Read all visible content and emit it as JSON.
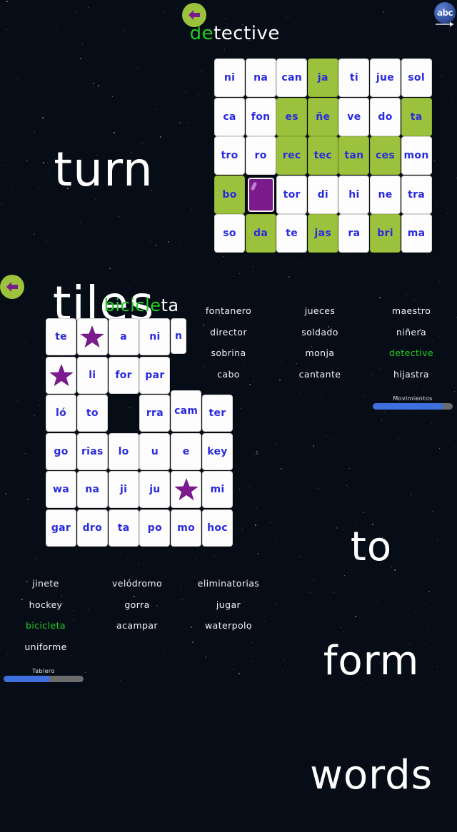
{
  "app": {
    "background_color": "#070d16",
    "tile_face_color": "#fdfdfd",
    "tile_green_color": "#9cc23d",
    "tile_purple_color": "#7a1a8c",
    "tile_text_color": "#2a2ae0",
    "found_word_color": "#1fd01f",
    "progress_fill_color": "#3f6fdc"
  },
  "headings": {
    "left_heading_line1": "turn",
    "left_heading_line2": "tiles",
    "right_heading_line1": "to",
    "right_heading_line2": "form",
    "right_heading_line3": "words"
  },
  "top_panel": {
    "back_button": {
      "name": "back-arrow-icon",
      "color": "#7a1a8c"
    },
    "abc_button": {
      "label": "abc",
      "name": "abc-icon"
    },
    "title": {
      "solved_part": "de",
      "remaining_part": "tective",
      "full": "detective"
    },
    "grid": {
      "columns": 7,
      "rows": 5,
      "tiles": [
        {
          "text": "ni",
          "state": "white"
        },
        {
          "text": "na",
          "state": "white"
        },
        {
          "text": "can",
          "state": "white"
        },
        {
          "text": "ja",
          "state": "green"
        },
        {
          "text": "ti",
          "state": "white"
        },
        {
          "text": "jue",
          "state": "white"
        },
        {
          "text": "sol",
          "state": "white"
        },
        {
          "text": "ca",
          "state": "white"
        },
        {
          "text": "fon",
          "state": "white"
        },
        {
          "text": "es",
          "state": "green"
        },
        {
          "text": "ñe",
          "state": "green"
        },
        {
          "text": "ve",
          "state": "white"
        },
        {
          "text": "do",
          "state": "white"
        },
        {
          "text": "ta",
          "state": "green"
        },
        {
          "text": "tro",
          "state": "white"
        },
        {
          "text": "ro",
          "state": "white"
        },
        {
          "text": "rec",
          "state": "green"
        },
        {
          "text": "tec",
          "state": "green"
        },
        {
          "text": "tan",
          "state": "green"
        },
        {
          "text": "ces",
          "state": "green"
        },
        {
          "text": "mon",
          "state": "white"
        },
        {
          "text": "bo",
          "state": "green"
        },
        {
          "text": "",
          "state": "purple"
        },
        {
          "text": "tor",
          "state": "white"
        },
        {
          "text": "di",
          "state": "white"
        },
        {
          "text": "hi",
          "state": "white"
        },
        {
          "text": "ne",
          "state": "white"
        },
        {
          "text": "tra",
          "state": "white"
        },
        {
          "text": "so",
          "state": "white"
        },
        {
          "text": "da",
          "state": "green"
        },
        {
          "text": "te",
          "state": "white"
        },
        {
          "text": "jas",
          "state": "green"
        },
        {
          "text": "ra",
          "state": "white"
        },
        {
          "text": "bri",
          "state": "green"
        },
        {
          "text": "ma",
          "state": "white"
        }
      ]
    }
  },
  "bottom_panel": {
    "back_button": {
      "name": "back-arrow-icon",
      "color": "#7a1a8c"
    },
    "title": {
      "solved_part": "bicicle",
      "remaining_part": "ta",
      "full": "bicicleta"
    },
    "grid": {
      "columns": 6,
      "rows": 6,
      "tiles": [
        {
          "text": "te",
          "state": "white"
        },
        {
          "text": "",
          "state": "star"
        },
        {
          "text": "a",
          "state": "white"
        },
        {
          "text": "ni",
          "state": "white"
        },
        {
          "text": "n",
          "state": "white"
        },
        {
          "text": "",
          "state": "empty"
        },
        {
          "text": "",
          "state": "star"
        },
        {
          "text": "li",
          "state": "white"
        },
        {
          "text": "for",
          "state": "white"
        },
        {
          "text": "par",
          "state": "white"
        },
        {
          "text": "",
          "state": "empty"
        },
        {
          "text": "",
          "state": "empty"
        },
        {
          "text": "ló",
          "state": "white"
        },
        {
          "text": "to",
          "state": "white"
        },
        {
          "text": "",
          "state": "empty"
        },
        {
          "text": "rra",
          "state": "white"
        },
        {
          "text": "cam",
          "state": "white"
        },
        {
          "text": "ter",
          "state": "white"
        },
        {
          "text": "go",
          "state": "white"
        },
        {
          "text": "rias",
          "state": "white"
        },
        {
          "text": "lo",
          "state": "white"
        },
        {
          "text": "u",
          "state": "white"
        },
        {
          "text": "e",
          "state": "white"
        },
        {
          "text": "key",
          "state": "white"
        },
        {
          "text": "wa",
          "state": "white"
        },
        {
          "text": "na",
          "state": "white"
        },
        {
          "text": "ji",
          "state": "white"
        },
        {
          "text": "ju",
          "state": "white"
        },
        {
          "text": "",
          "state": "star"
        },
        {
          "text": "mi",
          "state": "white"
        },
        {
          "text": "gar",
          "state": "white"
        },
        {
          "text": "dro",
          "state": "white"
        },
        {
          "text": "ta",
          "state": "white"
        },
        {
          "text": "po",
          "state": "white"
        },
        {
          "text": "mo",
          "state": "white"
        },
        {
          "text": "hoc",
          "state": "white"
        }
      ]
    }
  },
  "word_list_top": {
    "columns": 3,
    "words": [
      {
        "text": "fontanero",
        "found": false
      },
      {
        "text": "jueces",
        "found": false
      },
      {
        "text": "maestro",
        "found": false
      },
      {
        "text": "director",
        "found": false
      },
      {
        "text": "soldado",
        "found": false
      },
      {
        "text": "niñera",
        "found": false
      },
      {
        "text": "sobrina",
        "found": false
      },
      {
        "text": "monja",
        "found": false
      },
      {
        "text": "detective",
        "found": true
      },
      {
        "text": "cabo",
        "found": false
      },
      {
        "text": "cantante",
        "found": false
      },
      {
        "text": "hijastra",
        "found": false
      }
    ]
  },
  "word_list_bottom": {
    "columns": 3,
    "words": [
      {
        "text": "jinete",
        "found": false
      },
      {
        "text": "velódromo",
        "found": false
      },
      {
        "text": "eliminatorias",
        "found": false
      },
      {
        "text": "hockey",
        "found": false
      },
      {
        "text": "gorra",
        "found": false
      },
      {
        "text": "jugar",
        "found": false
      },
      {
        "text": "bicicleta",
        "found": true
      },
      {
        "text": "acampar",
        "found": false
      },
      {
        "text": "waterpolo",
        "found": false
      },
      {
        "text": "uniforme",
        "found": false
      }
    ]
  },
  "progress_bars": [
    {
      "label": "Movimientos",
      "percent": 88
    },
    {
      "label": "Tablero",
      "percent": 58
    }
  ]
}
